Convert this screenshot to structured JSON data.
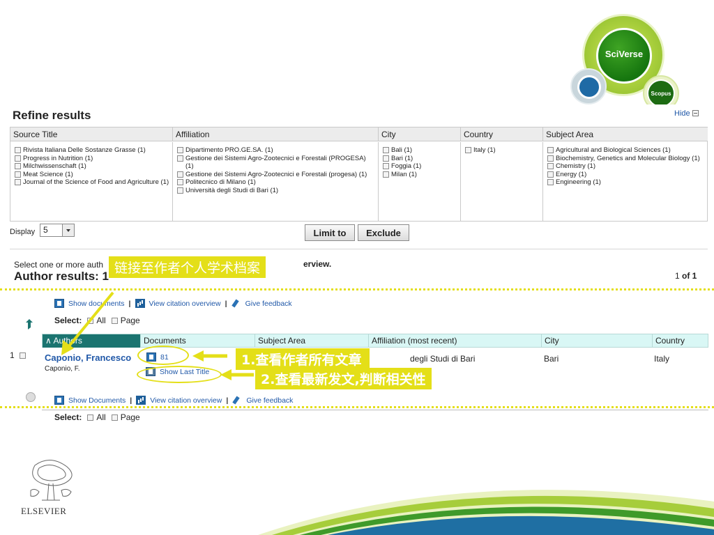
{
  "logo": {
    "sciverse": "SciVerse",
    "scopus": "Scopus"
  },
  "refine": {
    "title": "Refine results",
    "hide_label": "Hide"
  },
  "facets": {
    "source_title": {
      "header": "Source Title",
      "items": [
        "Rivista Italiana Delle Sostanze Grasse (1)",
        "Progress in Nutrition (1)",
        "Milchwissenschaft (1)",
        "Meat Science (1)",
        "Journal of the Science of Food and Agriculture (1)"
      ]
    },
    "affiliation": {
      "header": "Affiliation",
      "items": [
        "Dipartimento PRO.GE.SA. (1)",
        "Gestione dei Sistemi Agro-Zootecnici e Forestali (PROGESA) (1)",
        "Gestione dei Sistemi Agro-Zootecnici e Forestali (progesa) (1)",
        "Politecnico di Milano (1)",
        "Università degli Studi di Bari (1)"
      ]
    },
    "city": {
      "header": "City",
      "items": [
        "Bali (1)",
        "Bari (1)",
        "Foggia (1)",
        "Milan (1)"
      ]
    },
    "country": {
      "header": "Country",
      "items": [
        "Italy (1)"
      ]
    },
    "subject_area": {
      "header": "Subject Area",
      "items": [
        "Agricultural and Biological Sciences (1)",
        "Biochemistry, Genetics and Molecular Biology (1)",
        "Chemistry (1)",
        "Energy (1)",
        "Engineering (1)"
      ]
    }
  },
  "controls": {
    "display_label": "Display",
    "display_value": "5",
    "limit_to": "Limit to",
    "exclude": "Exclude"
  },
  "results": {
    "select_hint": "Select one or more auth",
    "overview_suffix": "erview.",
    "title": "Author results: 1",
    "page_of_prefix": "1 ",
    "page_of_suffix": "of 1"
  },
  "toolbar": {
    "show_documents_top": "Show documents",
    "show_documents_bottom": "Show Documents",
    "view_citation": "View citation overview",
    "give_feedback": "Give feedback",
    "select_label": "Select:",
    "all": "All",
    "page": "Page"
  },
  "table": {
    "headers": {
      "authors": "Authors",
      "documents": "Documents",
      "subject_area": "Subject Area",
      "affiliation": "Affiliation (most recent)",
      "city": "City",
      "country": "Country"
    },
    "rows": [
      {
        "index": "1",
        "name": "Caponio, Francesco",
        "variant": "Caponio, F.",
        "documents": "81",
        "show_last": "Show Last Title",
        "affiliation": "degli Studi di Bari",
        "city": "Bari",
        "country": "Italy"
      }
    ]
  },
  "annotations": {
    "profile": "链接至作者个人学术档案",
    "step1": "1.查看作者所有文章",
    "step2": "2.查看最新发文,判断相关性"
  },
  "footer": {
    "publisher": "ELSEVIER"
  },
  "colors": {
    "annotation": "#e4df18",
    "link": "#2058a8",
    "table_header": "#d9f7f5",
    "sort_header": "#1b7470"
  }
}
